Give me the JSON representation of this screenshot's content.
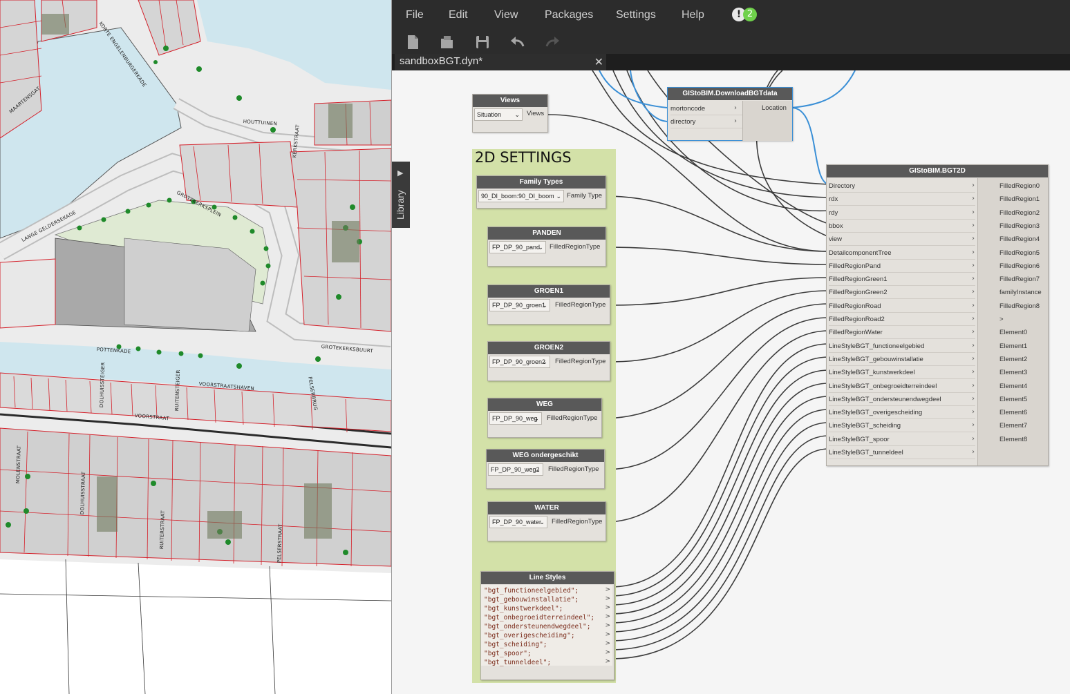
{
  "map": {
    "street_labels": [
      "KORTE ENGELENBURGERKADE",
      "MAARTENSGAT",
      "HOUTTUINEN",
      "LANGE GELDERSEKADE",
      "GROTEKERKSPLEIN",
      "KERKSTRAAT",
      "POTTENKADE",
      "GROTEKERKSBUURT",
      "VOORSTRAATSHAVEN",
      "VOORSTRAAT",
      "DOLHUISSTEIGER",
      "RUITENSTEIGER",
      "PELSERBRUG",
      "MOLENSTRAAT",
      "DOLHUISSTRAAT",
      "RUITERSTRAAT",
      "PELSERSTRAAT"
    ],
    "colors": {
      "water": "#cfe6ee",
      "parcel_line": "#d4202a",
      "building": "#cfcfcf",
      "green": "#dfead3",
      "tree": "#1f8a2a",
      "road": "#e9e9e9"
    }
  },
  "dynamo": {
    "menu": [
      "File",
      "Edit",
      "View",
      "Packages",
      "Settings",
      "Help"
    ],
    "notification": {
      "icon": "!",
      "count": "2"
    },
    "toolbar": [
      "new-file-icon",
      "open-file-icon",
      "save-icon",
      "undo-icon",
      "redo-icon"
    ],
    "tab": {
      "label": "sandboxBGT.dyn*",
      "close": "✕"
    },
    "library_label": "Library",
    "group": {
      "title": "2D SETTINGS",
      "color": "#d3e1a8"
    },
    "views_node": {
      "title": "Views",
      "dropdown": "Situation",
      "output": "Views"
    },
    "download_node": {
      "title": "GIStoBIM.DownloadBGTdata",
      "inputs": [
        "mortoncode",
        "directory"
      ],
      "output": "Location"
    },
    "settings_nodes": [
      {
        "title": "Family Types",
        "dropdown": "90_DI_boom:90_DI_boom",
        "output": "Family Type"
      },
      {
        "title": "PANDEN",
        "dropdown": "FP_DP_90_pand",
        "output": "FilledRegionType"
      },
      {
        "title": "GROEN1",
        "dropdown": "FP_DP_90_groen1",
        "output": "FilledRegionType"
      },
      {
        "title": "GROEN2",
        "dropdown": "FP_DP_90_groen2",
        "output": "FilledRegionType"
      },
      {
        "title": "WEG",
        "dropdown": "FP_DP_90_weg",
        "output": "FilledRegionType"
      },
      {
        "title": "WEG ondergeschikt",
        "dropdown": "FP_DP_90_weg2",
        "output": "FilledRegionType"
      },
      {
        "title": "WATER",
        "dropdown": "FP_DP_90_water",
        "output": "FilledRegionType"
      }
    ],
    "line_styles_node": {
      "title": "Line Styles",
      "lines": [
        "\"bgt_functioneelgebied\";",
        "\"bgt_gebouwinstallatie\";",
        "\"bgt_kunstwerkdeel\";",
        "\"bgt_onbegroeidterreindeel\";",
        "\"bgt_ondersteunendwegdeel\";",
        "\"bgt_overigescheiding\";",
        "\"bgt_scheiding\";",
        "\"bgt_spoor\";",
        "\"bgt_tunneldeel\";"
      ],
      "arrow": ">"
    },
    "bgt2d_node": {
      "title": "GIStoBIM.BGT2D",
      "inputs": [
        "Directory",
        "rdx",
        "rdy",
        "bbox",
        "view",
        "DetailcomponentTree",
        "FilledRegionPand",
        "FilledRegionGreen1",
        "FilledRegionGreen2",
        "FilledRegionRoad",
        "FilledRegionRoad2",
        "FilledRegionWater",
        "LineStyleBGT_functioneelgebied",
        "LineStyleBGT_gebouwinstallatie",
        "LineStyleBGT_kunstwerkdeel",
        "LineStyleBGT_onbegroeidterreindeel",
        "LineStyleBGT_ondersteunendwegdeel",
        "LineStyleBGT_overigescheiding",
        "LineStyleBGT_scheiding",
        "LineStyleBGT_spoor",
        "LineStyleBGT_tunneldeel"
      ],
      "outputs": [
        "FilledRegion0",
        "FilledRegion1",
        "FilledRegion2",
        "FilledRegion3",
        "FilledRegion4",
        "FilledRegion5",
        "FilledRegion6",
        "FilledRegion7",
        "familyInstance",
        "FilledRegion8",
        ">",
        "Element0",
        "Element1",
        "Element2",
        "Element3",
        "Element4",
        "Element5",
        "Element6",
        "Element7",
        "Element8"
      ]
    },
    "colors": {
      "menubar": "#2c2c2c",
      "canvas": "#f5f5f5",
      "node_header": "#595959",
      "node_body": "#e4e1dc",
      "wire": "#3c3c3c",
      "wire_selected": "#3a8fd6"
    }
  }
}
